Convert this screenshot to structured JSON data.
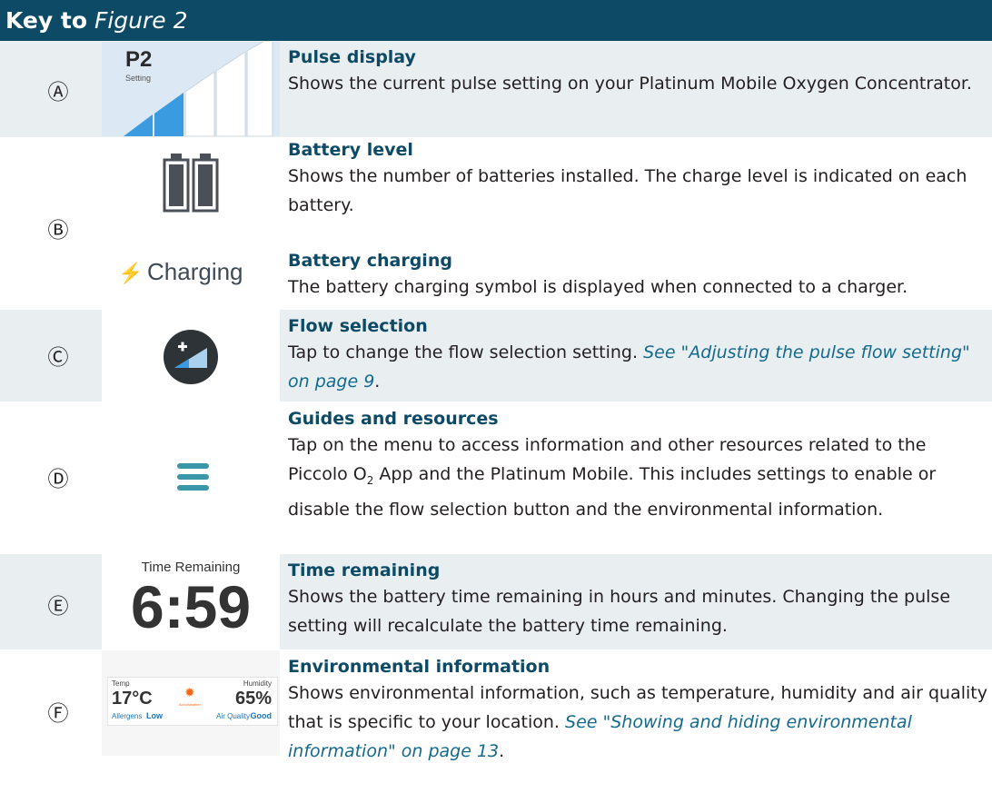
{
  "header": {
    "prefix": "Key to",
    "figure": "Figure 2"
  },
  "rows": [
    {
      "letter": "Ⓐ",
      "title": "Pulse display",
      "body": "Shows the current pulse setting on your Platinum Mobile Oxygen Concentrator."
    },
    {
      "letter": "Ⓑ",
      "title": "Battery level",
      "body": "Shows the number of batteries installed. The charge level is indicated on each battery."
    },
    {
      "title": "Battery charging",
      "body": "The battery charging symbol is displayed when connected to a charger."
    },
    {
      "letter": "Ⓒ",
      "title": "Flow selection",
      "body": "Tap to change the flow selection setting. ",
      "link": "See \"Adjusting the pulse flow setting\" on page 9",
      "after": "."
    },
    {
      "letter": "Ⓓ",
      "title": "Guides and resources",
      "body_a": "Tap on the menu to access information and other resources related to the Piccolo O",
      "sub": "2",
      "body_b": " App and the Platinum Mobile. This includes settings to enable or disable the flow selection button and the environmental information."
    },
    {
      "letter": "Ⓔ",
      "title": "Time remaining",
      "body": "Shows the battery time remaining in hours and minutes. Changing the pulse setting will recalculate the battery time remaining."
    },
    {
      "letter": "Ⓕ",
      "title": "Environmental information",
      "body": "Shows environmental information, such as temperature, humidity and air quality that is specific to your location. ",
      "link": "See \"Showing and hiding environmental information\" on page 13",
      "after": "."
    }
  ],
  "images": {
    "pulse": {
      "label": "P2",
      "sublabel": "Setting"
    },
    "charging": {
      "label": "Charging"
    },
    "time": {
      "label": "Time Remaining",
      "value": "6:59"
    },
    "env": {
      "temp_label": "Temp",
      "temp": "17°C",
      "hum_label": "Humidity",
      "hum": "65%",
      "allergens_label": "Allergens",
      "allergens": "Low",
      "air_label": "Air Quality",
      "air": "Good",
      "provider": "AccuWeather"
    }
  }
}
